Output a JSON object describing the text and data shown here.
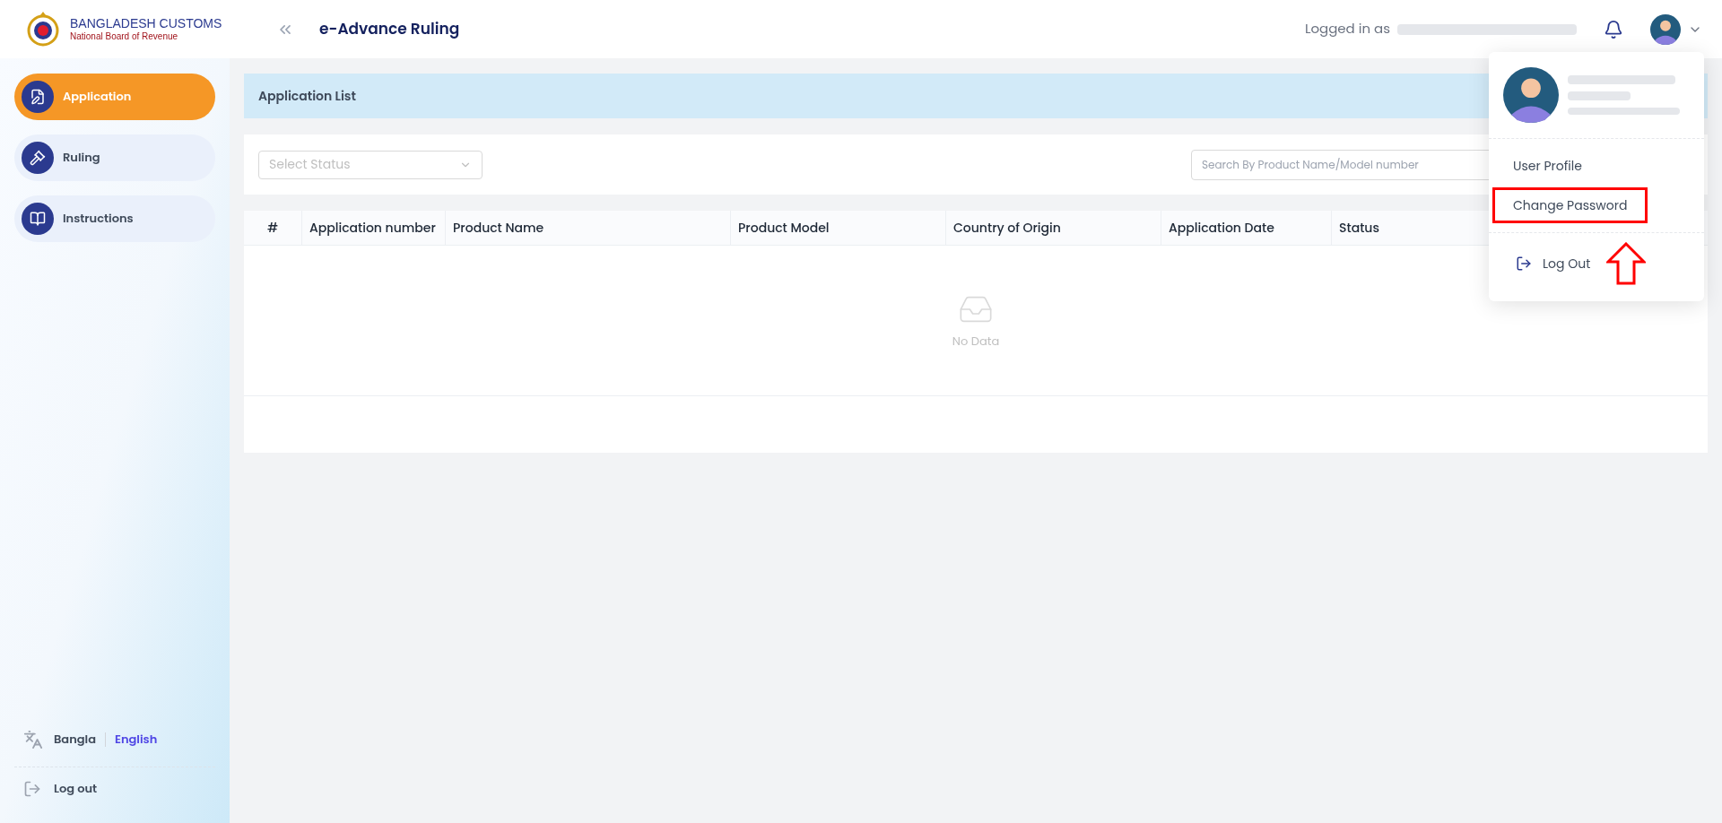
{
  "logo": {
    "title": "BANGLADESH CUSTOMS",
    "subtitle": "National Board of Revenue"
  },
  "header": {
    "title": "e-Advance Ruling",
    "logged_in_label": "Logged in as"
  },
  "sidebar": {
    "items": [
      {
        "label": "Application",
        "kind": "application",
        "selected": true
      },
      {
        "label": "Ruling",
        "kind": "ruling",
        "selected": false
      },
      {
        "label": "Instructions",
        "kind": "instructions",
        "selected": false
      }
    ],
    "languages": [
      {
        "label": "Bangla",
        "selected": false
      },
      {
        "label": "English",
        "selected": true
      }
    ],
    "logout": "Log out"
  },
  "page": {
    "title": "Application List",
    "status_select": {
      "placeholder": "Select Status"
    },
    "search": {
      "placeholder": "Search By Product Name/Model number"
    }
  },
  "table": {
    "columns": [
      "#",
      "Application number",
      "Product Name",
      "Product Model",
      "Country of Origin",
      "Application Date",
      "Status"
    ],
    "empty_text": "No Data"
  },
  "user_menu": {
    "items": [
      {
        "label": "User Profile",
        "highlighted": false
      },
      {
        "label": "Change Password",
        "highlighted": true
      }
    ],
    "logout": "Log Out"
  }
}
